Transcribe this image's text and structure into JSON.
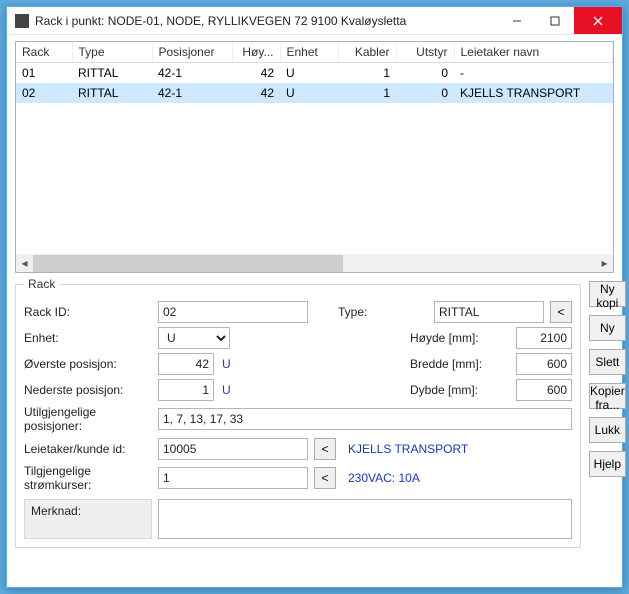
{
  "window": {
    "title": "Rack i punkt: NODE-01, NODE, RYLLIKVEGEN 72 9100 Kvaløysletta"
  },
  "grid": {
    "headers": {
      "rack": "Rack",
      "type": "Type",
      "posisjoner": "Posisjoner",
      "hoyde": "Høy...",
      "enhet": "Enhet",
      "kabler": "Kabler",
      "utstyr": "Utstyr",
      "leietaker": "Leietaker navn"
    },
    "rows": [
      {
        "rack": "01",
        "type": "RITTAL",
        "posisjoner": "42-1",
        "hoyde": "42",
        "enhet": "U",
        "kabler": "1",
        "utstyr": "0",
        "leietaker": "-",
        "selected": false
      },
      {
        "rack": "02",
        "type": "RITTAL",
        "posisjoner": "42-1",
        "hoyde": "42",
        "enhet": "U",
        "kabler": "1",
        "utstyr": "0",
        "leietaker": "KJELLS TRANSPORT",
        "selected": true
      }
    ]
  },
  "form": {
    "legend": "Rack",
    "labels": {
      "rack_id": "Rack ID:",
      "type": "Type:",
      "enhet": "Enhet:",
      "hoyde": "Høyde [mm]:",
      "overste": "Øverste posisjon:",
      "bredde": "Bredde [mm]:",
      "nederste": "Nederste posisjon:",
      "dybde": "Dybde [mm]:",
      "utilgj": "Utilgjengelige posisjoner:",
      "leietaker": "Leietaker/kunde id:",
      "strom": "Tilgjengelige strømkurser:",
      "merknad": "Merknad:"
    },
    "values": {
      "rack_id": "02",
      "type": "RITTAL",
      "enhet": "U",
      "hoyde": "2100",
      "overste": "42",
      "overste_unit": "U",
      "bredde": "600",
      "nederste": "1",
      "nederste_unit": "U",
      "dybde": "600",
      "utilgj": "1, 7, 13, 17, 33",
      "leietaker_id": "10005",
      "leietaker_navn": "KJELLS TRANSPORT",
      "strom_id": "1",
      "strom_desc": "230VAC: 10A",
      "merknad": ""
    },
    "lookup_btn": "<"
  },
  "buttons": {
    "ny_kopi": "Ny kopi",
    "ny": "Ny",
    "slett": "Slett",
    "kopier_fra": "Kopier fra...",
    "lukk": "Lukk",
    "hjelp": "Hjelp"
  }
}
